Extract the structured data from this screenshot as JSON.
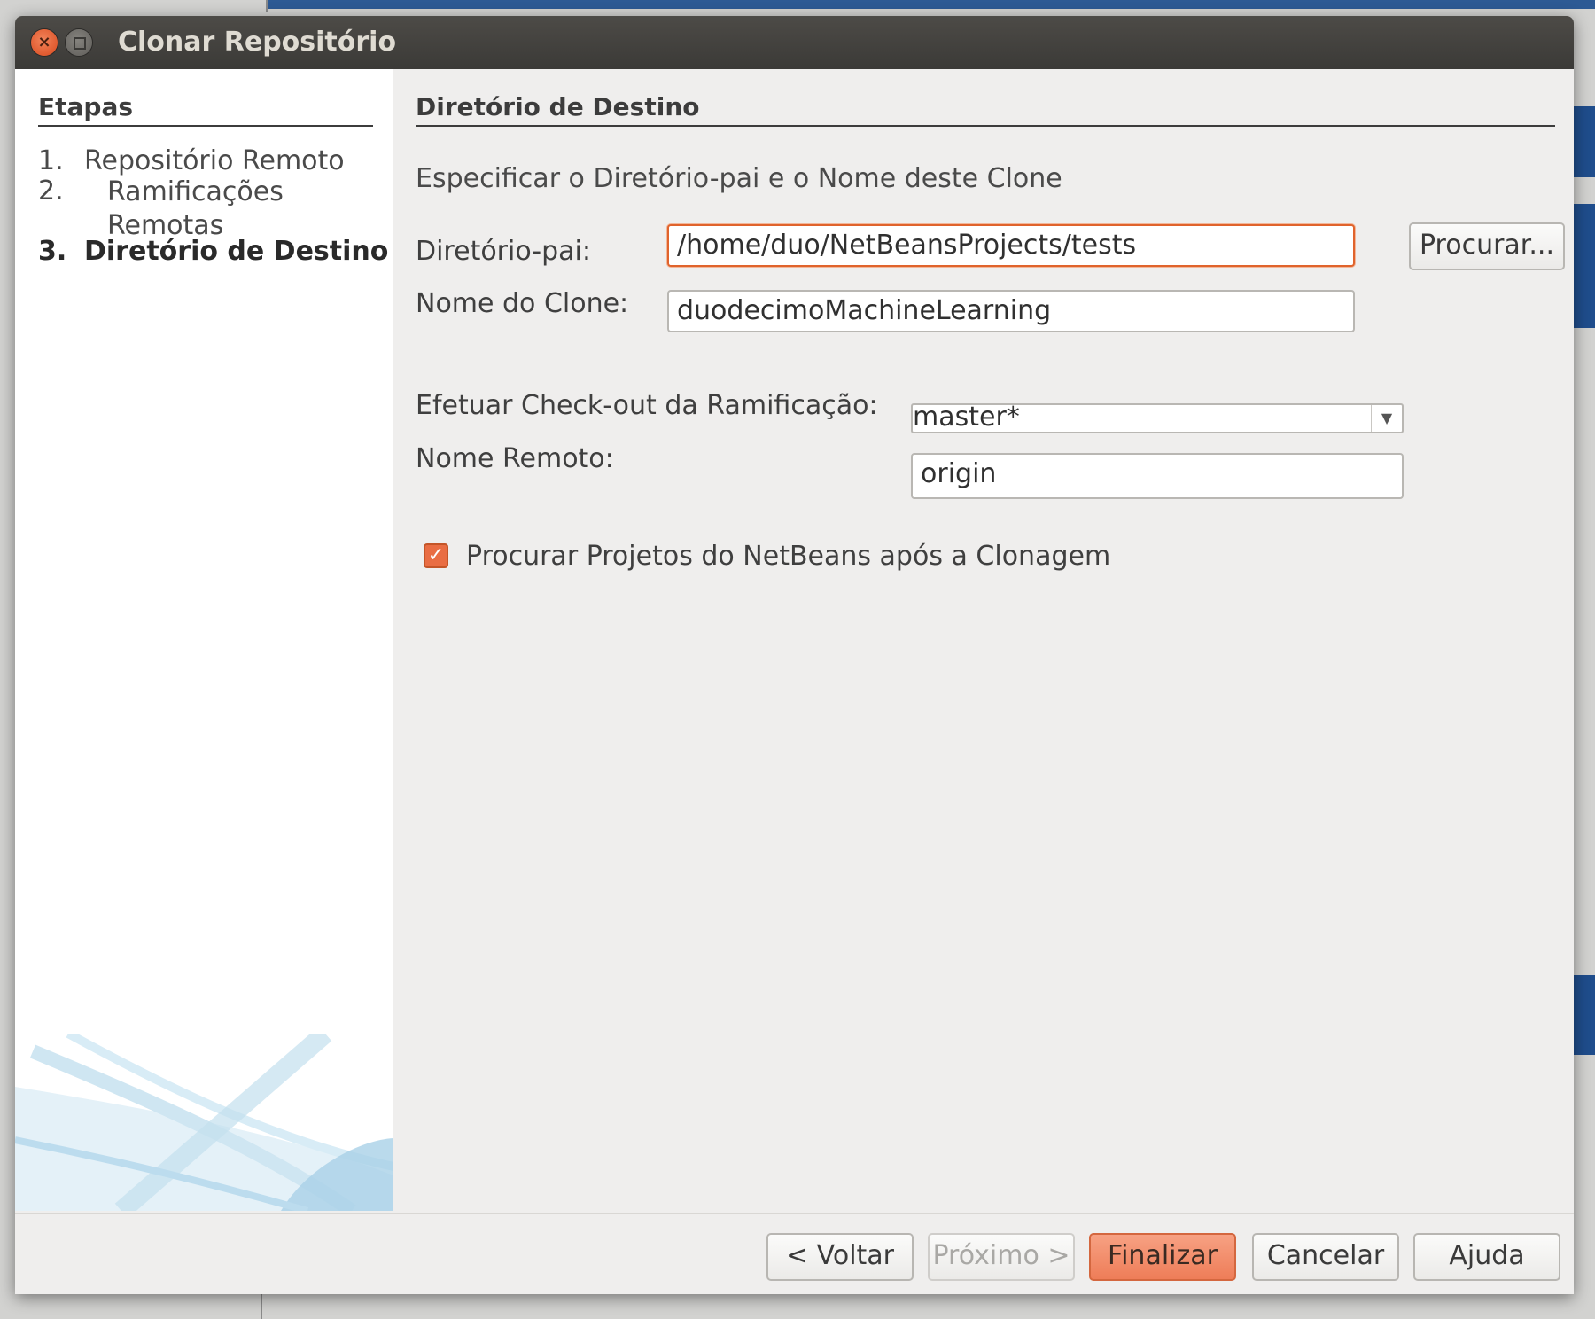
{
  "window": {
    "title": "Clonar Repositório"
  },
  "steps": {
    "header": "Etapas",
    "items": [
      {
        "num": "1.",
        "label": "Repositório Remoto"
      },
      {
        "num": "2.",
        "label_line1": "Ramificações",
        "label_line2": "Remotas"
      },
      {
        "num": "3.",
        "label": "Diretório de Destino",
        "current": true
      }
    ]
  },
  "main": {
    "title": "Diretório de Destino",
    "subtitle": "Especificar o Diretório-pai e o Nome deste Clone",
    "parent_dir": {
      "label": "Diretório-pai:",
      "value": "/home/duo/NetBeansProjects/tests"
    },
    "browse_button": "Procurar...",
    "clone_name": {
      "label": "Nome do Clone:",
      "value": "duodecimoMachineLearning"
    },
    "checkout_branch": {
      "label": "Efetuar Check-out da Ramificação:",
      "selected": "master*"
    },
    "remote_name": {
      "label": "Nome Remoto:",
      "value": "origin"
    },
    "scan_projects": {
      "label": "Procurar Projetos do NetBeans após a Clonagem",
      "checked": true
    }
  },
  "footer": {
    "back": "< Voltar",
    "next": "Próximo >",
    "finish": "Finalizar",
    "cancel": "Cancelar",
    "help": "Ajuda"
  },
  "colors": {
    "accent": "#e96d43",
    "titlebar": "#3b3a37",
    "dialog_bg": "#efeeed"
  }
}
